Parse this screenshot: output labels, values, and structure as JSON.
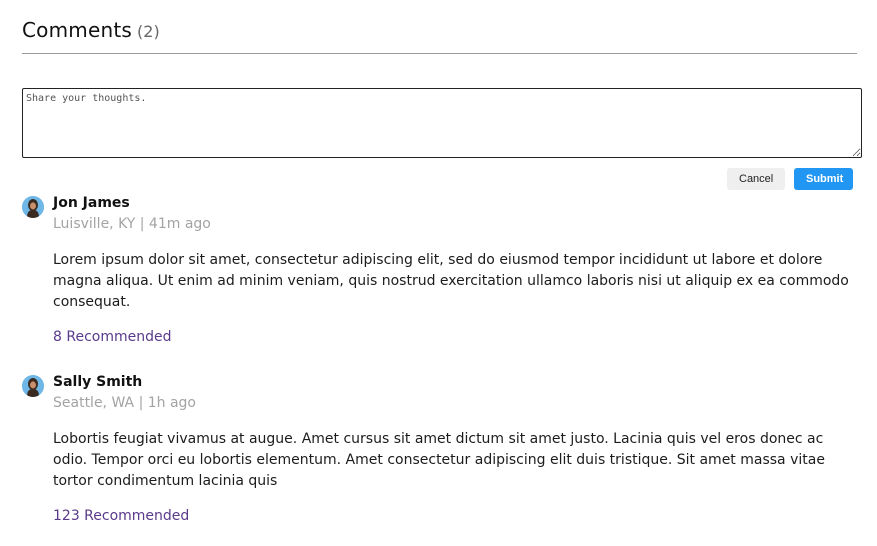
{
  "header": {
    "title": "Comments",
    "count": "(2)"
  },
  "composer": {
    "placeholder": "Share your thoughts.",
    "value": ""
  },
  "actions": {
    "cancel_label": "Cancel",
    "submit_label": "Submit"
  },
  "colors": {
    "submit_bg": "#2196f3",
    "recommend_text": "#5a3a8a",
    "meta_text": "#a3a3a3",
    "avatar_bg": "#6fb7e6"
  },
  "comments": [
    {
      "author": "Jon James",
      "meta": "Luisville, KY | 41m ago",
      "body": "Lorem ipsum dolor sit amet, consectetur adipiscing elit, sed do eiusmod tempor incididunt ut labore et dolore magna aliqua. Ut enim ad minim veniam, quis nostrud exercitation ullamco laboris nisi ut aliquip ex ea commodo consequat.",
      "recommended": "8 Recommended",
      "avatar_icon": "person-avatar-icon"
    },
    {
      "author": "Sally Smith",
      "meta": "Seattle, WA | 1h ago",
      "body": "Lobortis feugiat vivamus at augue. Amet cursus sit amet dictum sit amet justo. Lacinia quis vel eros donec ac odio. Tempor orci eu lobortis elementum. Amet consectetur adipiscing elit duis tristique. Sit amet massa vitae tortor condimentum lacinia quis",
      "recommended": "123 Recommended",
      "avatar_icon": "person-avatar-icon"
    }
  ]
}
